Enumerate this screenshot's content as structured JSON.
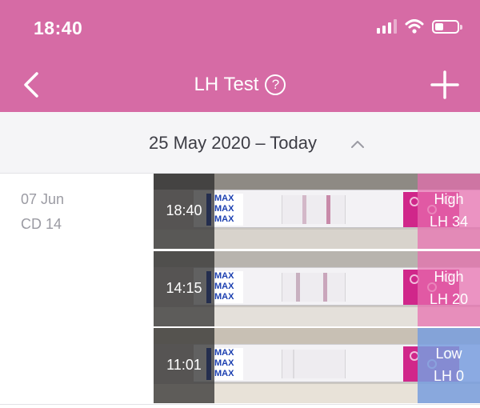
{
  "status_bar": {
    "time": "18:40"
  },
  "nav": {
    "title": "LH Test",
    "help_icon": "?"
  },
  "date_bar": {
    "label": "25 May 2020 – Today"
  },
  "day": {
    "date": "07 Jun",
    "cycle_day": "CD 14"
  },
  "tests": [
    {
      "time": "18:40",
      "level": "High",
      "value": "LH 34"
    },
    {
      "time": "14:15",
      "level": "High",
      "value": "LH 20"
    },
    {
      "time": "11:01",
      "level": "Low",
      "value": "LH 0"
    }
  ],
  "strip_label": "MAX",
  "colors": {
    "brand": "#d66ba5",
    "high": "#e86eaf",
    "low": "#789ede"
  },
  "icons": [
    "back-chevron-icon",
    "help-icon",
    "add-icon",
    "signal-icon",
    "wifi-icon",
    "battery-icon",
    "chevron-up-icon"
  ]
}
